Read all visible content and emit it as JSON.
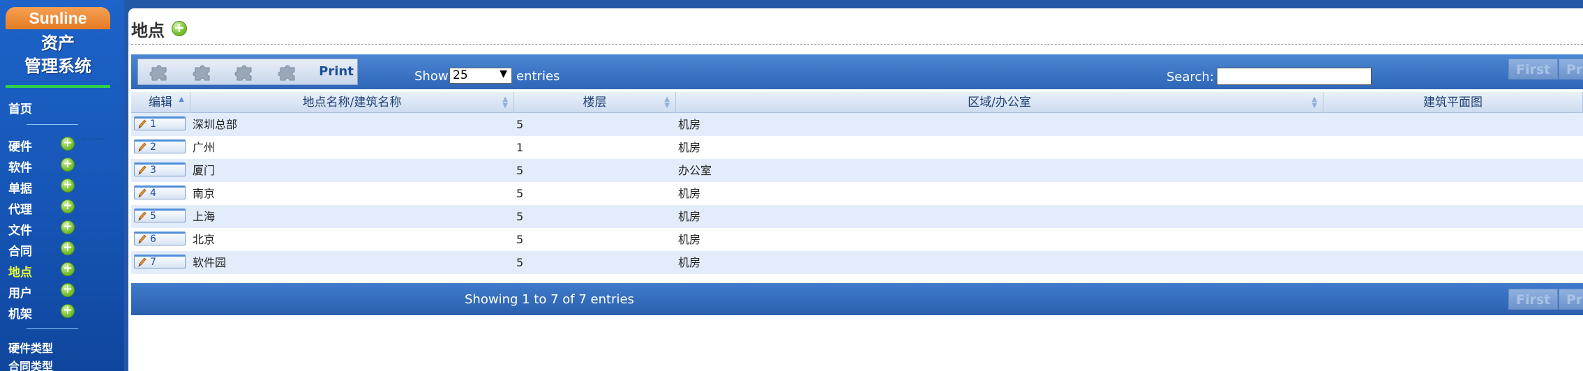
{
  "sidebar": {
    "brand": "Sunline",
    "system_title_line1": "资产",
    "system_title_line2": "管理系统",
    "home": "首页",
    "items": [
      {
        "label": "硬件"
      },
      {
        "label": "软件"
      },
      {
        "label": "单据"
      },
      {
        "label": "代理"
      },
      {
        "label": "文件"
      },
      {
        "label": "合同"
      },
      {
        "label": "地点",
        "active": true
      },
      {
        "label": "用户"
      },
      {
        "label": "机架"
      }
    ],
    "types": [
      "硬件类型",
      "合同类型"
    ]
  },
  "page": {
    "title": "地点"
  },
  "toolbar": {
    "print_label": "Print",
    "show_label": "Show",
    "entries_label": "entries",
    "page_length": "25",
    "search_label": "Search:",
    "search_value": "",
    "pager": {
      "first": "First",
      "prev": "Pre"
    }
  },
  "table": {
    "columns": [
      "编辑",
      "地点名称/建筑名称",
      "楼层",
      "区域/办公室",
      "建筑平面图"
    ],
    "rows": [
      {
        "id": "1",
        "name": "深圳总部",
        "floor": "5",
        "area": "机房"
      },
      {
        "id": "2",
        "name": "广州",
        "floor": "1",
        "area": "机房"
      },
      {
        "id": "3",
        "name": "厦门",
        "floor": "5",
        "area": "办公室"
      },
      {
        "id": "4",
        "name": "南京",
        "floor": "5",
        "area": "机房"
      },
      {
        "id": "5",
        "name": "上海",
        "floor": "5",
        "area": "机房"
      },
      {
        "id": "6",
        "name": "北京",
        "floor": "5",
        "area": "机房"
      },
      {
        "id": "7",
        "name": "软件园",
        "floor": "5",
        "area": "机房"
      }
    ],
    "info": "Showing 1 to 7 of 7 entries"
  },
  "colors": {
    "background": "#2458a6",
    "brand_orange": "#e57b23",
    "accent_green": "#2ed04a",
    "active_menu": "#e8ff3a",
    "row_alt": "#e2ecfb"
  }
}
